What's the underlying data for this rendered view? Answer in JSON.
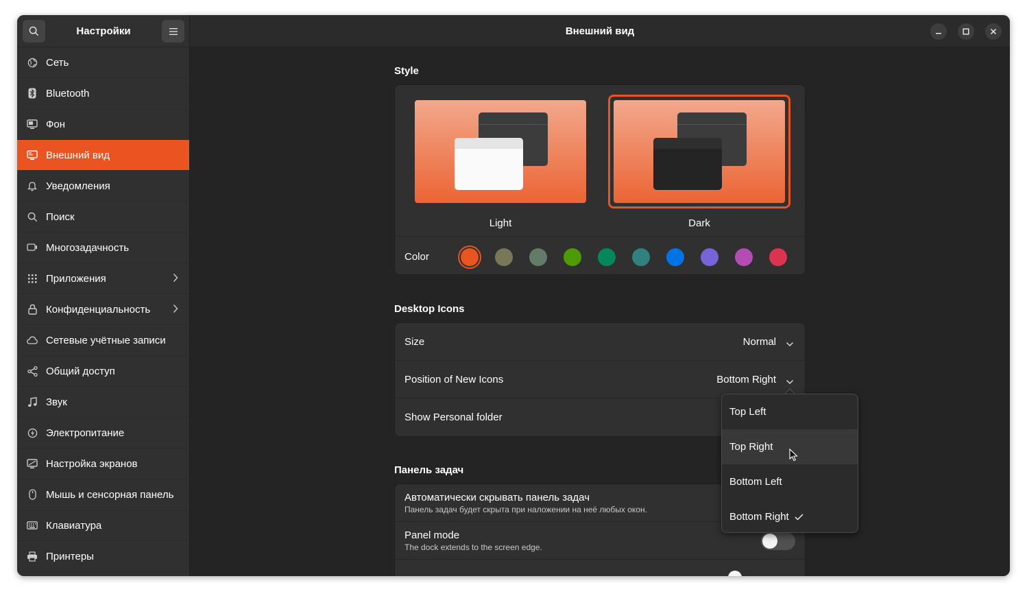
{
  "sidebar": {
    "title": "Настройки",
    "items": [
      {
        "label": "Сеть",
        "icon": "globe-icon"
      },
      {
        "label": "Bluetooth",
        "icon": "bluetooth-icon"
      },
      {
        "label": "Фон",
        "icon": "display-icon"
      },
      {
        "label": "Внешний вид",
        "icon": "appearance-icon"
      },
      {
        "label": "Уведомления",
        "icon": "bell-icon"
      },
      {
        "label": "Поиск",
        "icon": "search-icon"
      },
      {
        "label": "Многозадачность",
        "icon": "multitasking-icon"
      },
      {
        "label": "Приложения",
        "icon": "apps-grid-icon"
      },
      {
        "label": "Конфиденциальность",
        "icon": "lock-icon"
      },
      {
        "label": "Сетевые учётные записи",
        "icon": "cloud-icon"
      },
      {
        "label": "Общий доступ",
        "icon": "share-icon"
      },
      {
        "label": "Звук",
        "icon": "music-note-icon"
      },
      {
        "label": "Электропитание",
        "icon": "power-icon"
      },
      {
        "label": "Настройка экранов",
        "icon": "monitor-icon"
      },
      {
        "label": "Мышь и сенсорная панель",
        "icon": "mouse-icon"
      },
      {
        "label": "Клавиатура",
        "icon": "keyboard-icon"
      },
      {
        "label": "Принтеры",
        "icon": "printer-icon"
      }
    ]
  },
  "header": {
    "title": "Внешний вид"
  },
  "style": {
    "section_title": "Style",
    "light_label": "Light",
    "dark_label": "Dark",
    "color_label": "Color",
    "accent_colors": [
      "#e95420",
      "#787859",
      "#657b69",
      "#4e9a06",
      "#03875b",
      "#308280",
      "#0073e5",
      "#7764d8",
      "#b34cb3",
      "#da3450"
    ]
  },
  "desktop_icons": {
    "section_title": "Desktop Icons",
    "size_label": "Size",
    "size_value": "Normal",
    "position_label": "Position of New Icons",
    "position_value": "Bottom Right",
    "personal_folder_label": "Show Personal folder"
  },
  "dock": {
    "section_title": "Панель задач",
    "autohide_title": "Автоматически скрывать панель задач",
    "autohide_sub": "Панель задач будет скрыта при наложении на неё любых окон.",
    "panel_mode_title": "Panel mode",
    "panel_mode_sub": "The dock extends to the screen edge."
  },
  "position_popover": {
    "options": [
      "Top Left",
      "Top Right",
      "Bottom Left",
      "Bottom Right"
    ],
    "selected": "Bottom Right"
  }
}
